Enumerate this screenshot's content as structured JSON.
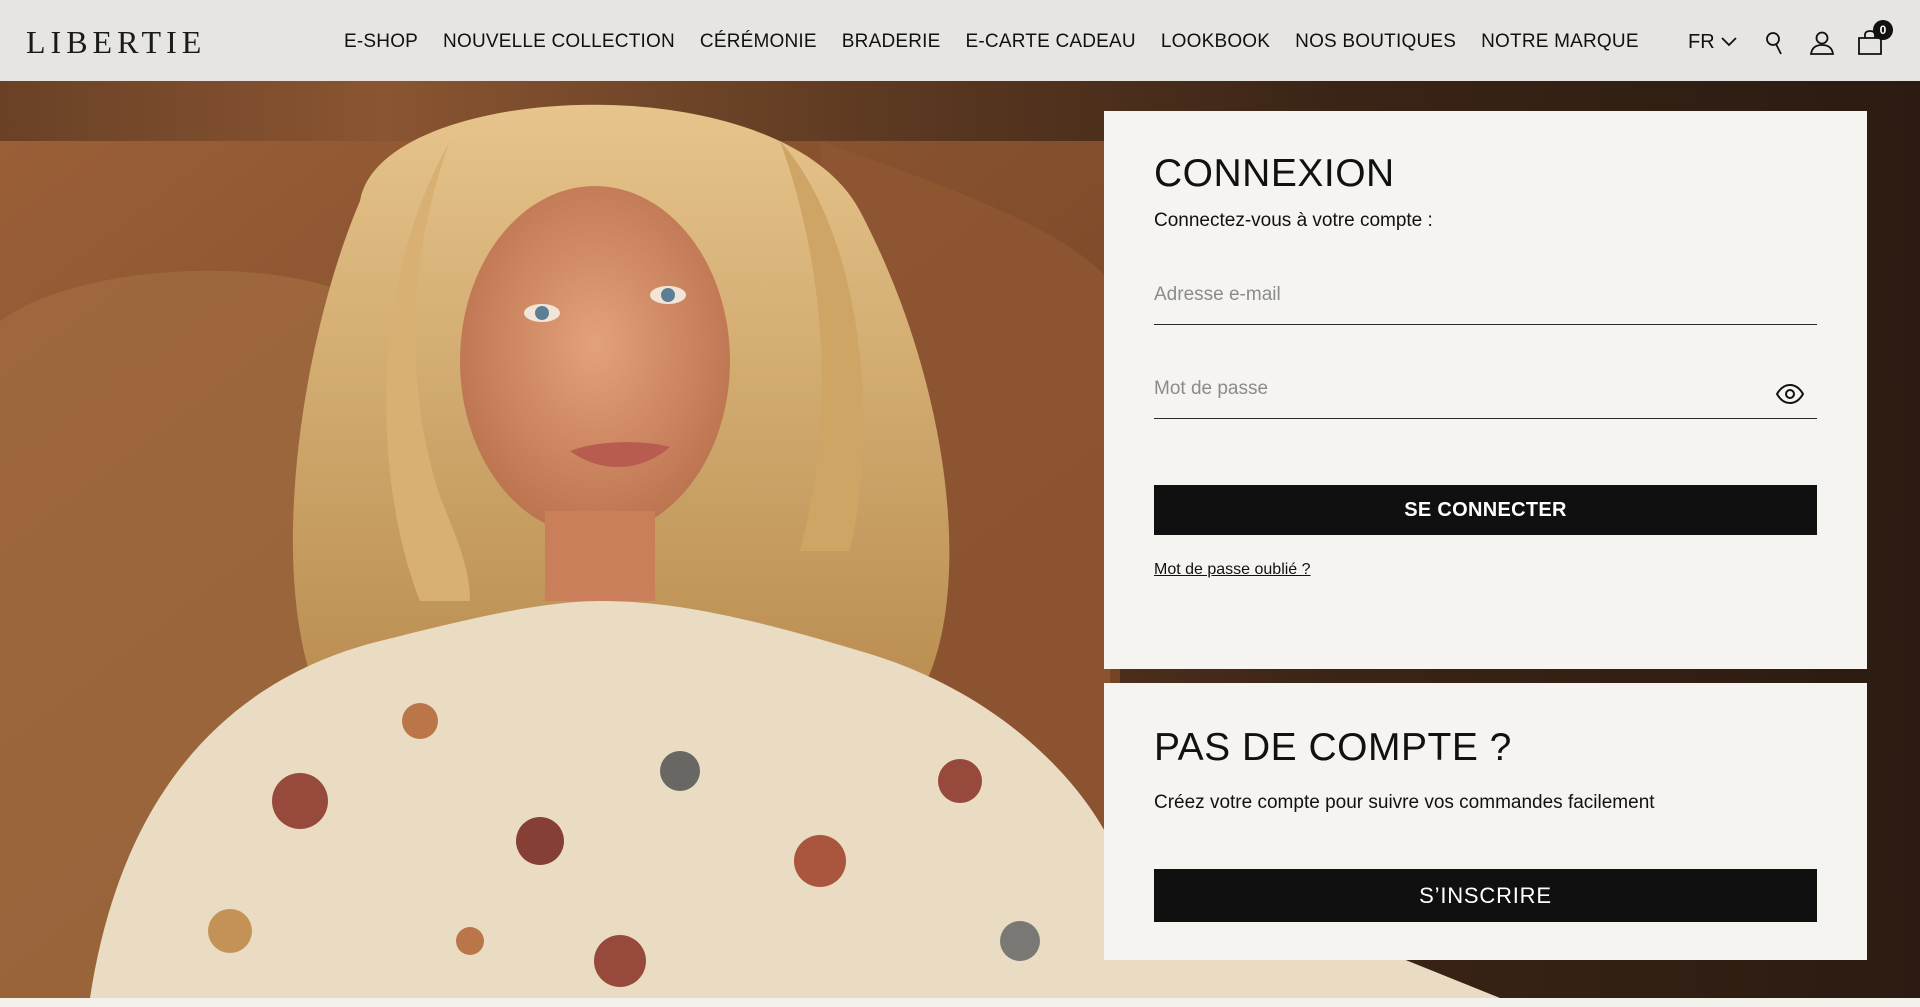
{
  "brand": {
    "logo_text": "LIBERTIE"
  },
  "nav": {
    "items": [
      "E-SHOP",
      "NOUVELLE COLLECTION",
      "CÉRÉMONIE",
      "BRADERIE",
      "E-CARTE CADEAU",
      "LOOKBOOK",
      "NOS BOUTIQUES",
      "NOTRE MARQUE"
    ]
  },
  "header": {
    "language": "FR",
    "cart_count": "0",
    "icons": [
      "chevron-down-icon",
      "search-icon",
      "account-icon",
      "cart-icon"
    ]
  },
  "login": {
    "title": "CONNEXION",
    "subtitle": "Connectez-vous à votre compte :",
    "email_placeholder": "Adresse e-mail",
    "email_value": "",
    "password_placeholder": "Mot de passe",
    "password_value": "",
    "submit_label": "SE CONNECTER",
    "forgot_label": "Mot de passe oublié ?"
  },
  "signup": {
    "title": "PAS DE COMPTE ?",
    "subtitle": "Créez votre compte pour suivre vos commandes facilement",
    "button_label": "S’INSCRIRE"
  },
  "colors": {
    "header_bg": "#e7e5e1",
    "panel_bg": "#f5f4f0",
    "button_bg": "#101010",
    "text": "#111111"
  }
}
